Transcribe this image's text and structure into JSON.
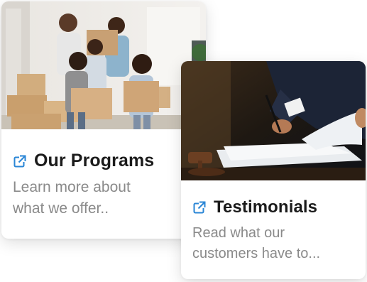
{
  "colors": {
    "link_icon": "#2a86d6",
    "title_text": "#1b1b1b",
    "description_text": "#8a8a8a"
  },
  "cards": [
    {
      "title": "Our Programs",
      "description_lines": [
        "Learn more about",
        "what we offer.."
      ],
      "icon": "external-link-icon",
      "image": "family-moving-boxes-photo"
    },
    {
      "title": "Testimonials",
      "description_lines": [
        "Read what our",
        "customers have to..."
      ],
      "icon": "external-link-icon",
      "image": "signing-documents-photo"
    }
  ]
}
